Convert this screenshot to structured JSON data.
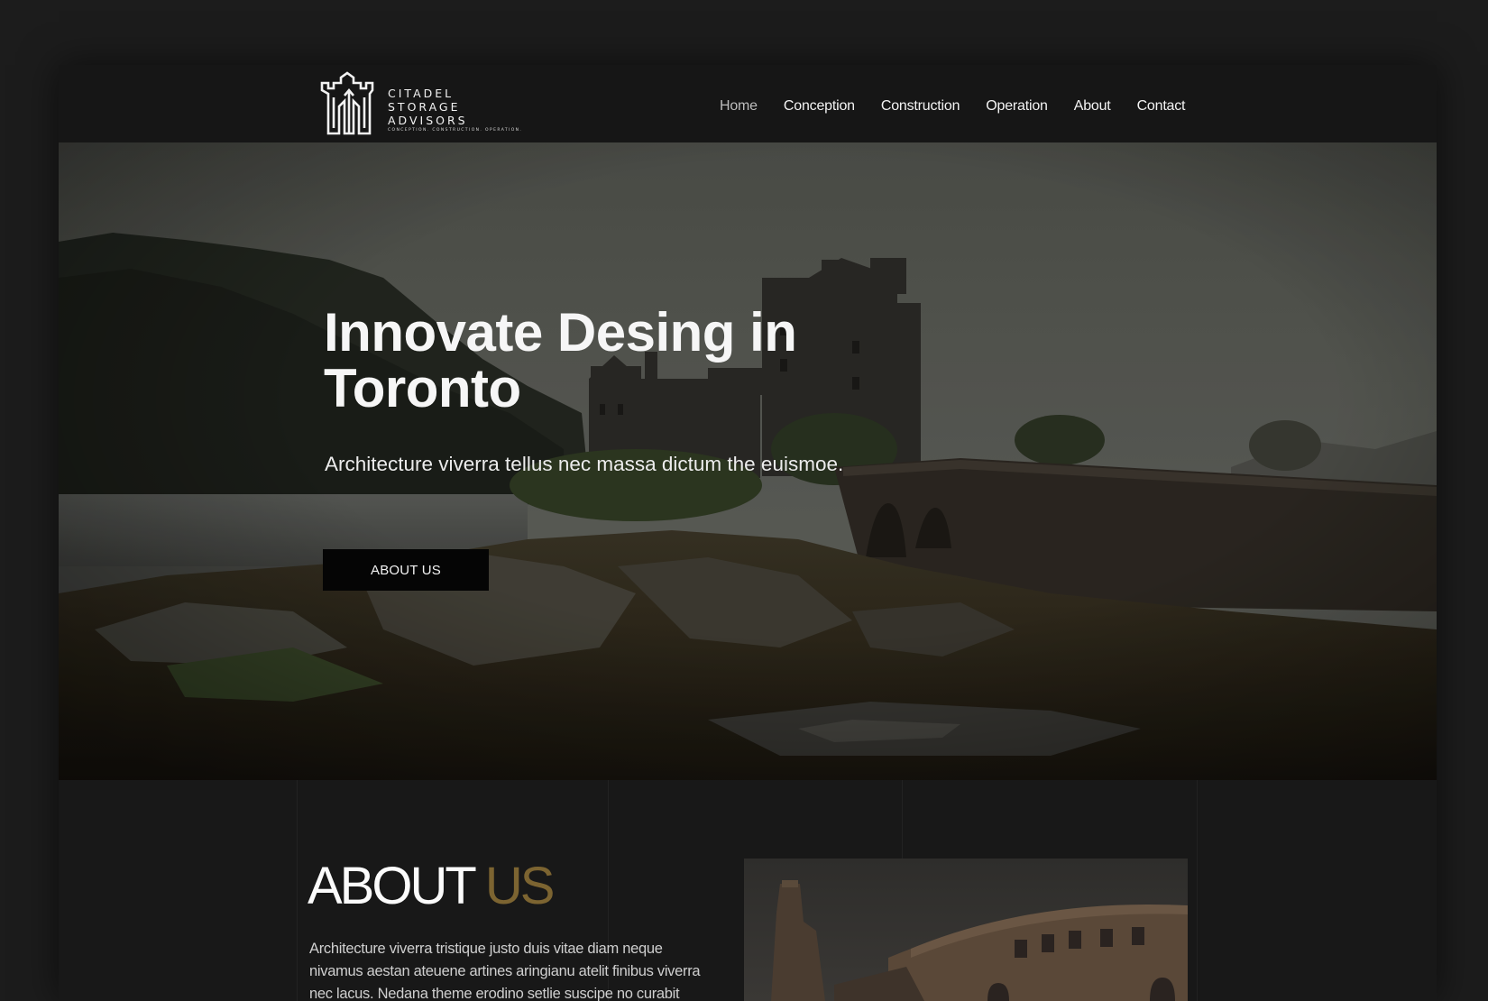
{
  "brand": {
    "line1": "CITADEL",
    "line2": "STORAGE",
    "line3": "ADVISORS",
    "tagline": "CONCEPTION. CONSTRUCTION. OPERATION."
  },
  "nav": {
    "items": [
      {
        "label": "Home",
        "active": true
      },
      {
        "label": "Conception"
      },
      {
        "label": "Construction"
      },
      {
        "label": "Operation"
      },
      {
        "label": "About"
      },
      {
        "label": "Contact"
      }
    ]
  },
  "hero": {
    "title_line1": "Innovate Desing in",
    "title_line2": "Toronto",
    "subtitle": "Architecture viverra tellus nec massa dictum the euismoe.",
    "button": "ABOUT US"
  },
  "about": {
    "heading_white": "ABOUT",
    "heading_gold": "US",
    "body": "Architecture viverra tristique justo duis vitae diam neque nivamus aestan ateuene artines aringianu atelit finibus viverra nec lacus. Nedana theme erodino setlie suscipe no curabit"
  },
  "colors": {
    "accent_gold": "#7c6431",
    "background": "#161616",
    "button": "#050505"
  }
}
